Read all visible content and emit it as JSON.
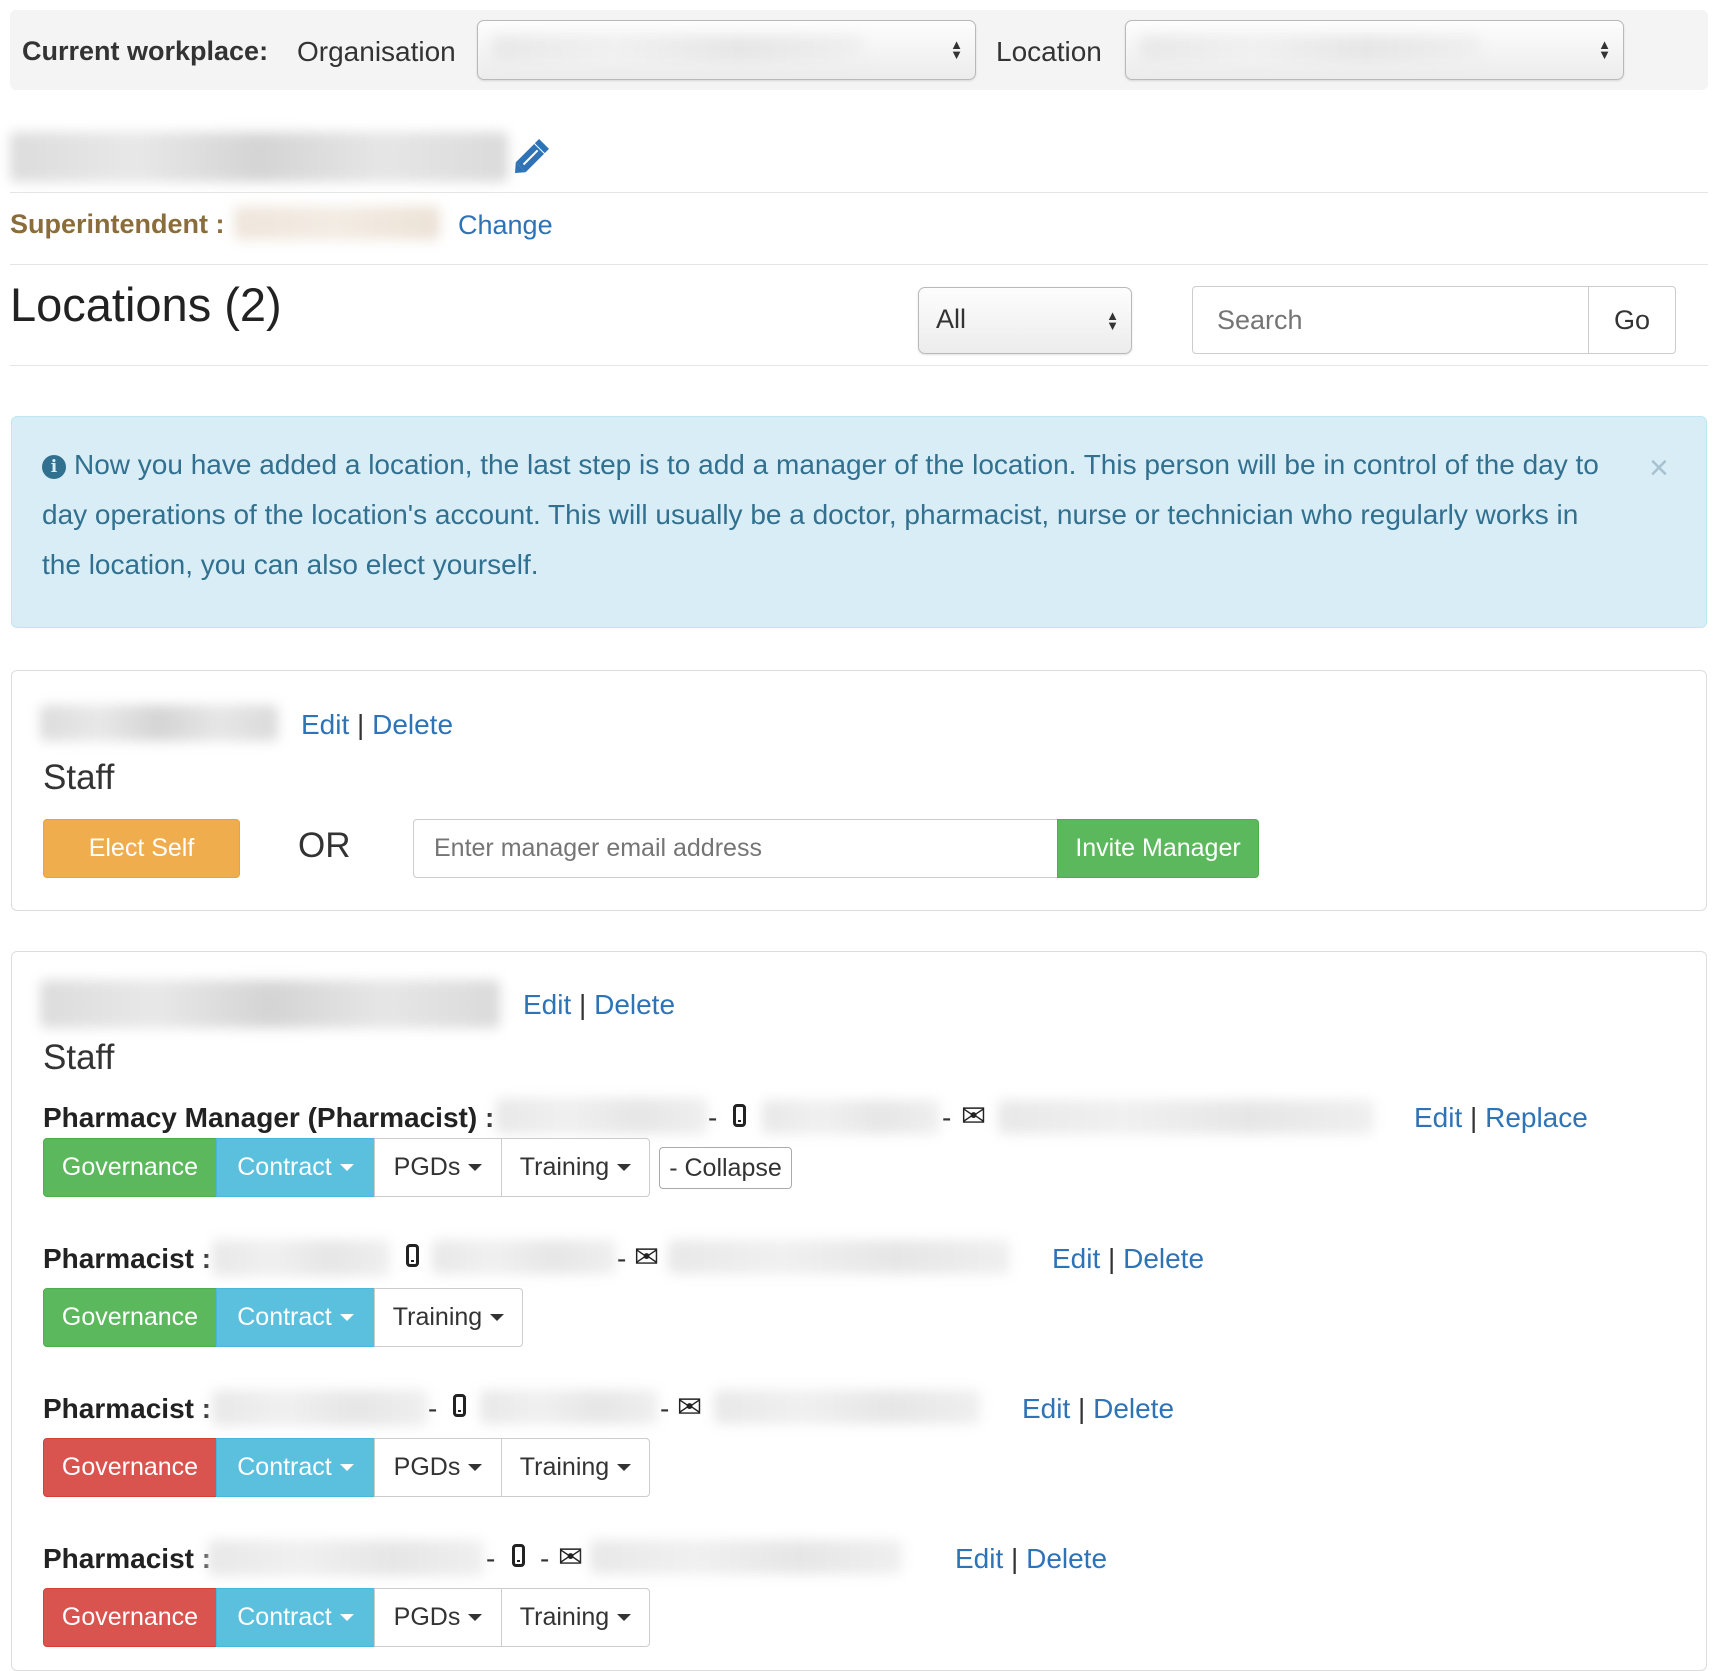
{
  "workplace": {
    "label": "Current workplace:",
    "organisation_label": "Organisation",
    "location_label": "Location"
  },
  "org": {
    "superintendent_label": "Superintendent :",
    "change_link": "Change"
  },
  "locations": {
    "title": "Locations (2)",
    "filter_value": "All",
    "search_placeholder": "Search",
    "go_label": "Go"
  },
  "alert": {
    "message": "Now you have added a location, the last step is to add a manager of the location. This person will be in control of the day to day operations of the location's account. This will usually be a doctor, pharmacist, nurse or technician who regularly works in the location, you can also elect yourself.",
    "close": "×"
  },
  "location1": {
    "edit": "Edit",
    "delete": "Delete",
    "staff_heading": "Staff",
    "elect_self": "Elect Self",
    "or_label": "OR",
    "email_placeholder": "Enter manager email address",
    "invite_manager": "Invite Manager"
  },
  "location2": {
    "edit": "Edit",
    "delete": "Delete",
    "staff_heading": "Staff",
    "members": [
      {
        "role": "Pharmacy Manager (Pharmacist) :",
        "action1": "Edit",
        "action2": "Replace",
        "governance": "Governance",
        "governance_status": "green",
        "contract": "Contract",
        "pgds": "PGDs",
        "training": "Training",
        "collapse": "- Collapse"
      },
      {
        "role": "Pharmacist :",
        "action1": "Edit",
        "action2": "Delete",
        "governance": "Governance",
        "governance_status": "green",
        "contract": "Contract",
        "training": "Training"
      },
      {
        "role": "Pharmacist :",
        "action1": "Edit",
        "action2": "Delete",
        "governance": "Governance",
        "governance_status": "red",
        "contract": "Contract",
        "pgds": "PGDs",
        "training": "Training"
      },
      {
        "role": "Pharmacist :",
        "action1": "Edit",
        "action2": "Delete",
        "governance": "Governance",
        "governance_status": "red",
        "contract": "Contract",
        "pgds": "PGDs",
        "training": "Training"
      }
    ]
  },
  "separators": {
    "pipe": "|",
    "dash": "-"
  },
  "colors": {
    "link": "#2f73b7",
    "success": "#5cb85c",
    "danger": "#d9534f",
    "info": "#5bc0de",
    "warning": "#f0ad4e",
    "superintendent": "#8a6d3b",
    "alert_bg": "#d9edf7",
    "alert_text": "#31708f"
  },
  "icons": [
    "pencil-icon",
    "info-circle-icon",
    "close-icon",
    "mobile-phone-icon",
    "envelope-icon",
    "caret-down-icon",
    "sort-arrows-icon"
  ]
}
